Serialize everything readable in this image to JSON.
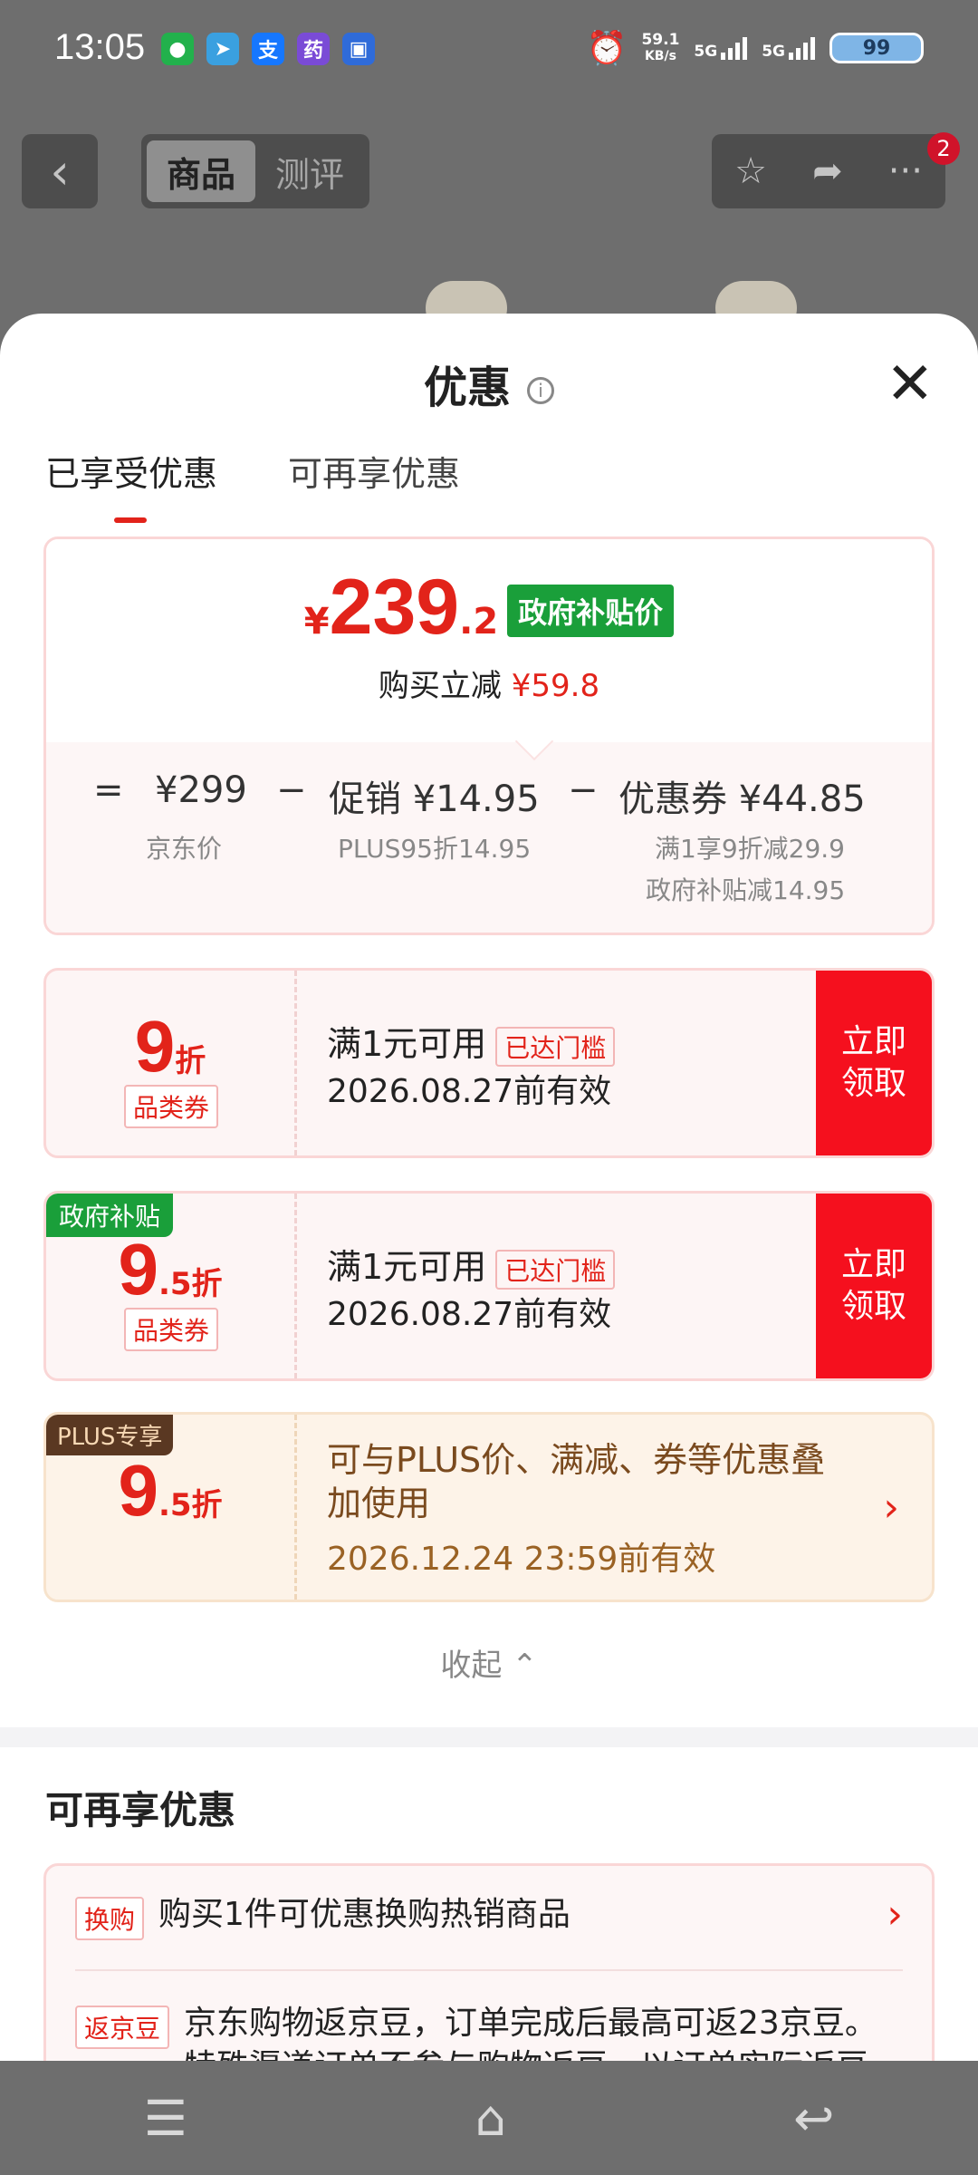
{
  "status": {
    "time": "13:05",
    "apps": [
      {
        "icon": "wechat-icon",
        "glyph": "●",
        "color": "#22b14c"
      },
      {
        "icon": "telegram-icon",
        "glyph": "➤",
        "color": "#3aa0e0"
      },
      {
        "icon": "alipay-icon",
        "glyph": "支",
        "color": "#1677ff"
      },
      {
        "icon": "pharmacy-icon",
        "glyph": "药",
        "color": "#7a4bd6"
      },
      {
        "icon": "message-icon",
        "glyph": "▣",
        "color": "#2f6bd9"
      }
    ],
    "speed_value": "59.1",
    "speed_unit": "KB/s",
    "net1": "5G",
    "net2": "5G",
    "battery": "99"
  },
  "header": {
    "seg_product": "商品",
    "seg_review": "测评",
    "badge": "2"
  },
  "sheet": {
    "title": "优惠",
    "tabs": [
      "已享受优惠",
      "可再享优惠"
    ]
  },
  "price": {
    "currency": "¥",
    "integer": "239",
    "decimal": ".2",
    "tag": "政府补贴价",
    "reduce_label": "购买立减",
    "reduce_value": "¥59.8",
    "eq": "=",
    "base": "¥299",
    "base_label": "京东价",
    "minus1": "−",
    "promo": "促销 ¥14.95",
    "promo_label": "PLUS95折14.95",
    "minus2": "−",
    "coupon": "优惠券 ¥44.85",
    "coupon_label1": "满1享9折减29.9",
    "coupon_label2": "政府补贴减14.95"
  },
  "coupons": [
    {
      "num": "9",
      "unit": "折",
      "category": "品类券",
      "condition": "满1元可用",
      "reached": "已达门槛",
      "valid": "2026.08.27前有效",
      "button": "立即\n领取"
    },
    {
      "corner": "政府补贴",
      "num": "9",
      "unit": ".5折",
      "category": "品类券",
      "condition": "满1元可用",
      "reached": "已达门槛",
      "valid": "2026.08.27前有效",
      "button": "立即\n领取"
    }
  ],
  "plus": {
    "tag": "PLUS专享",
    "num": "9",
    "unit": ".5折",
    "desc": "可与PLUS价、满减、券等优惠叠加使用",
    "valid": "2026.12.24 23:59前有效"
  },
  "collapse": "收起",
  "more": {
    "title": "可再享优惠",
    "rows": [
      {
        "label": "换购",
        "text": "购买1件可优惠换购热销商品"
      },
      {
        "label": "返京豆",
        "text": "京东购物返京豆，订单完成后最高可返23京豆。特殊渠道订单不参与购物返豆，以订单实际返豆"
      }
    ]
  }
}
